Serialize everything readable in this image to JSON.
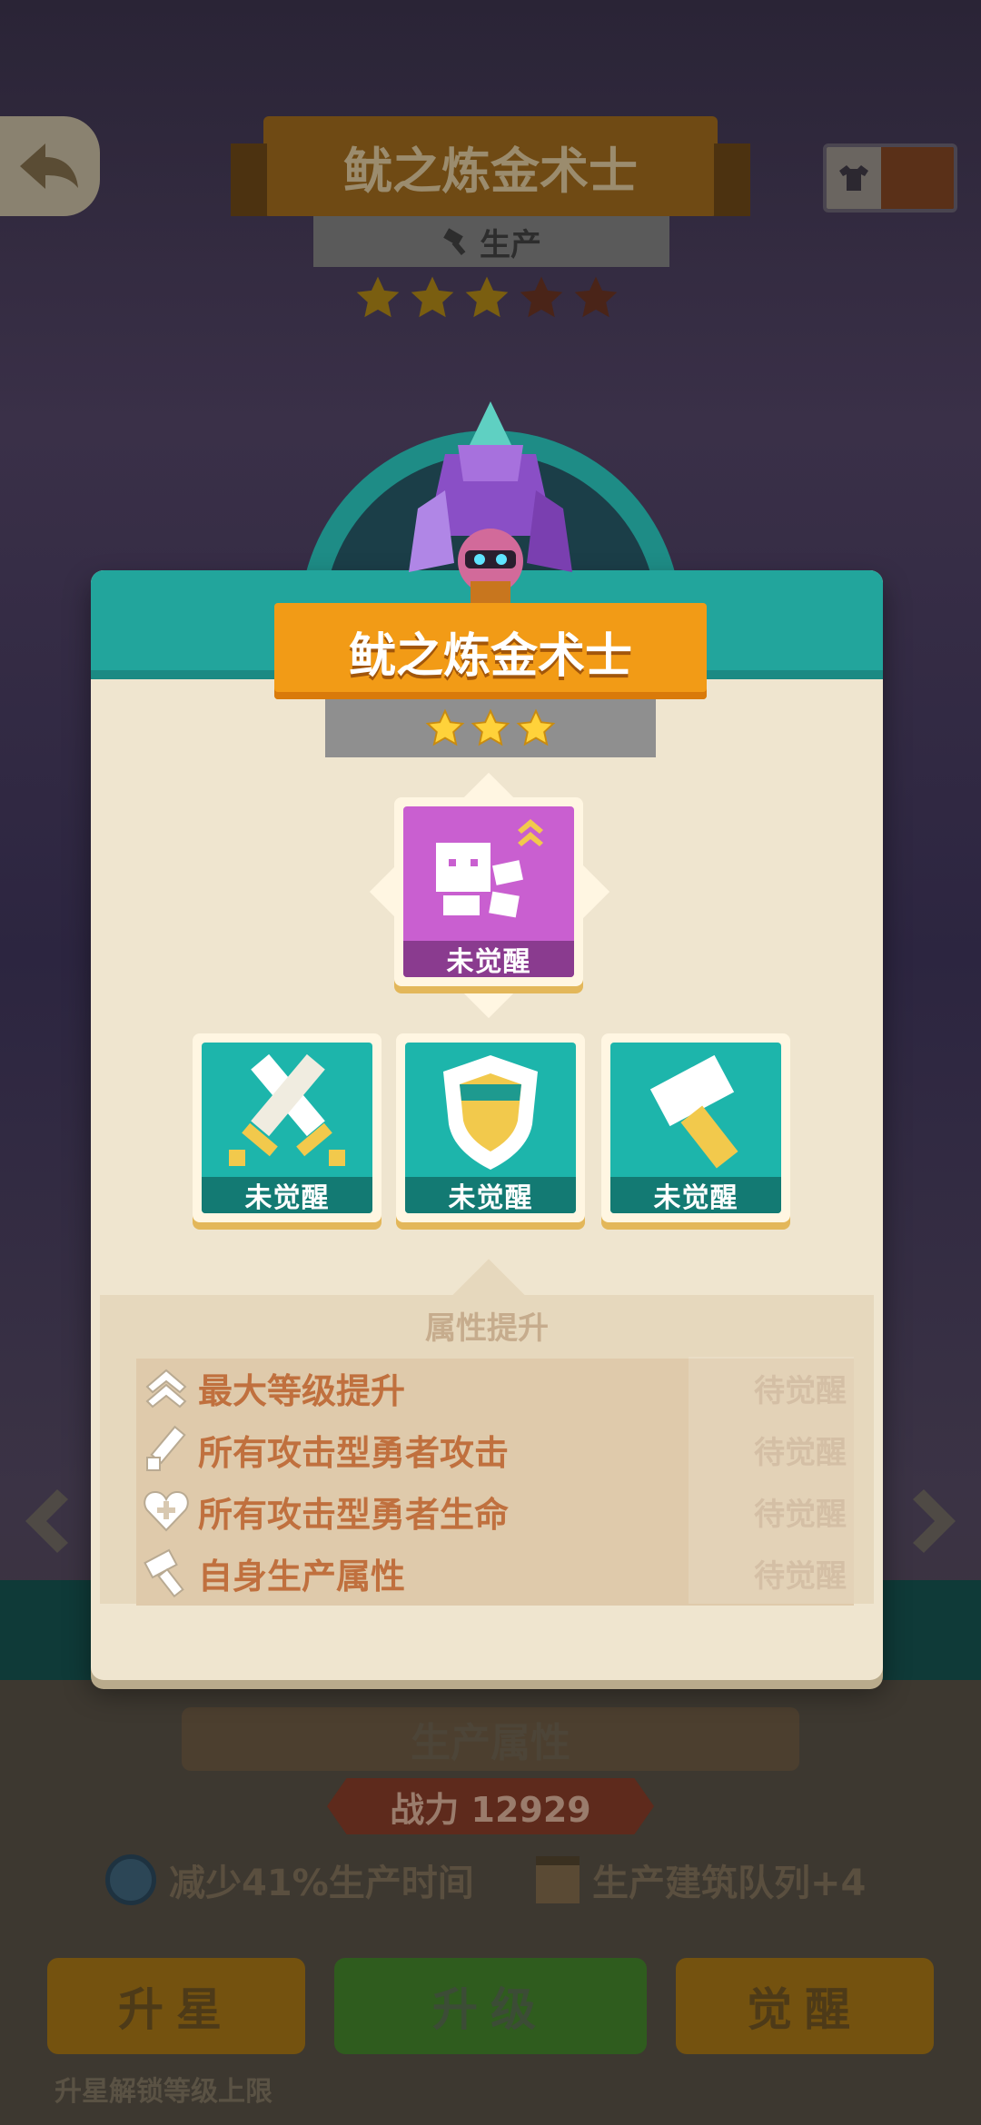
{
  "background": {
    "hero_title": "鱿之炼金术士",
    "hero_type": "生产",
    "hero_stars_total": 5,
    "hero_stars_filled": 3,
    "section_title": "生产属性",
    "power": "战力 12929",
    "attr_time": "减少41%生产时间",
    "attr_queue": "生产建筑队列+4",
    "buttons": {
      "star_up": "升星",
      "level_up": "升级",
      "awaken": "觉醒"
    },
    "footer_hint": "升星解锁等级上限"
  },
  "modal": {
    "title": "鱿之炼金术士",
    "stars": 3,
    "top_node": {
      "label": "未觉醒",
      "icon": "hero-awaken-icon"
    },
    "sub_nodes": [
      {
        "label": "未觉醒",
        "icon": "crossed-swords-icon"
      },
      {
        "label": "未觉醒",
        "icon": "shield-icon"
      },
      {
        "label": "未觉醒",
        "icon": "hammer-icon"
      }
    ],
    "attr_title": "属性提升",
    "attributes": [
      {
        "name": "最大等级提升",
        "status": "待觉醒",
        "icon": "double-chevron-up-icon"
      },
      {
        "name": "所有攻击型勇者攻击",
        "status": "待觉醒",
        "icon": "sword-icon"
      },
      {
        "name": "所有攻击型勇者生命",
        "status": "待觉醒",
        "icon": "heart-plus-icon"
      },
      {
        "name": "自身生产属性",
        "status": "待觉醒",
        "icon": "hammer-icon"
      }
    ]
  },
  "colors": {
    "teal": "#22a59c",
    "orange": "#f29b16",
    "purple": "#c95fd0",
    "attr_text": "#c0703e"
  }
}
